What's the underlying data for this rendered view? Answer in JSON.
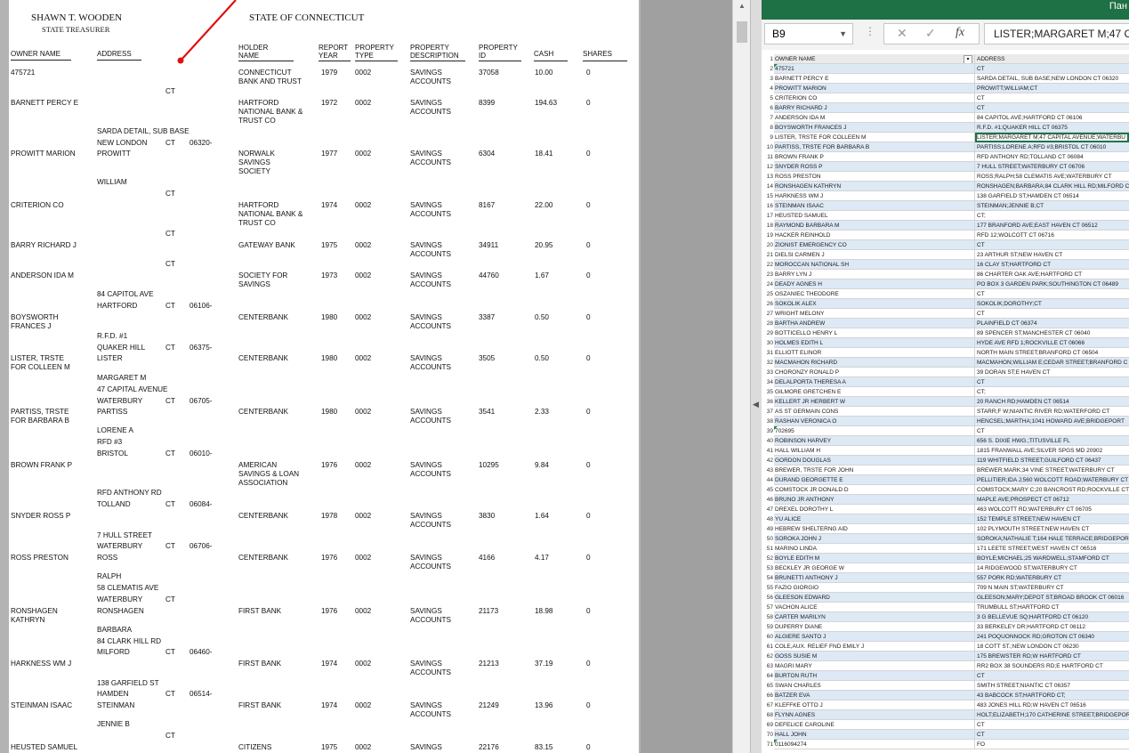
{
  "document": {
    "header_left_name": "SHAWN T. WOODEN",
    "header_left_title": "STATE TREASURER",
    "header_center": "STATE OF CONNECTICUT",
    "columns": {
      "owner_name": "OWNER NAME",
      "address": "ADDRESS",
      "holder_name_1": "HOLDER",
      "holder_name_2": "NAME",
      "report_year_1": "REPORT",
      "report_year_2": "YEAR",
      "property_type_1": "PROPERTY",
      "property_type_2": "TYPE",
      "property_desc_1": "PROPERTY",
      "property_desc_2": "DESCRIPTION",
      "property_id_1": "PROPERTY",
      "property_id_2": "ID",
      "cash": "CASH",
      "shares": "SHARES"
    },
    "address_fragments": [
      "CT",
      "SARDA DETAIL, SUB BASE",
      "NEW LONDON",
      "CT",
      "06320-",
      "PROWITT",
      "WILLIAM",
      "CT",
      "CT",
      "CT",
      "84 CAPITOL AVE",
      "HARTFORD",
      "CT",
      "06106-",
      "R.F.D. #1",
      "QUAKER HILL",
      "CT",
      "06375-",
      "LISTER",
      "MARGARET M",
      "47 CAPITAL AVENUE",
      "WATERBURY",
      "CT",
      "06705-",
      "PARTISS",
      "LORENE A",
      "RFD #3",
      "BRISTOL",
      "CT",
      "06010-",
      "RFD ANTHONY RD",
      "TOLLAND",
      "CT",
      "06084-",
      "7 HULL STREET",
      "WATERBURY",
      "CT",
      "06706-",
      "ROSS",
      "RALPH",
      "58 CLEMATIS AVE",
      "WATERBURY",
      "CT",
      "RONSHAGEN",
      "BARBARA",
      "84 CLARK HILL RD",
      "MILFORD",
      "CT",
      "06460-",
      "138 GARFIELD ST",
      "HAMDEN",
      "CT",
      "06514-",
      "STEINMAN",
      "JENNIE B",
      "CT"
    ],
    "records": [
      {
        "owner": [
          "475721"
        ],
        "holder": [
          "CONNECTICUT",
          "BANK AND TRUST"
        ],
        "year": "1979",
        "type": "0002",
        "desc": [
          "SAVINGS",
          "ACCOUNTS"
        ],
        "id": "37058",
        "cash": "10.00",
        "shares": "0"
      },
      {
        "owner": [
          "BARNETT PERCY E"
        ],
        "holder": [
          "HARTFORD",
          "NATIONAL BANK &",
          "TRUST CO"
        ],
        "year": "1972",
        "type": "0002",
        "desc": [
          "SAVINGS",
          "ACCOUNTS"
        ],
        "id": "8399",
        "cash": "194.63",
        "shares": "0"
      },
      {
        "owner": [
          "PROWITT MARION"
        ],
        "holder": [
          "NORWALK",
          "SAVINGS",
          "SOCIETY"
        ],
        "year": "1977",
        "type": "0002",
        "desc": [
          "SAVINGS",
          "ACCOUNTS"
        ],
        "id": "6304",
        "cash": "18.41",
        "shares": "0"
      },
      {
        "owner": [
          "CRITERION CO"
        ],
        "holder": [
          "HARTFORD",
          "NATIONAL BANK &",
          "TRUST CO"
        ],
        "year": "1974",
        "type": "0002",
        "desc": [
          "SAVINGS",
          "ACCOUNTS"
        ],
        "id": "8167",
        "cash": "22.00",
        "shares": "0"
      },
      {
        "owner": [
          "BARRY RICHARD J"
        ],
        "holder": [
          "GATEWAY BANK"
        ],
        "year": "1975",
        "type": "0002",
        "desc": [
          "SAVINGS",
          "ACCOUNTS"
        ],
        "id": "34911",
        "cash": "20.95",
        "shares": "0"
      },
      {
        "owner": [
          "ANDERSON IDA M"
        ],
        "holder": [
          "SOCIETY FOR",
          "SAVINGS"
        ],
        "year": "1973",
        "type": "0002",
        "desc": [
          "SAVINGS",
          "ACCOUNTS"
        ],
        "id": "44760",
        "cash": "1.67",
        "shares": "0"
      },
      {
        "owner": [
          "BOYSWORTH",
          "FRANCES J"
        ],
        "holder": [
          "CENTERBANK"
        ],
        "year": "1980",
        "type": "0002",
        "desc": [
          "SAVINGS",
          "ACCOUNTS"
        ],
        "id": "3387",
        "cash": "0.50",
        "shares": "0"
      },
      {
        "owner": [
          "LISTER, TRSTE",
          "FOR COLLEEN M"
        ],
        "holder": [
          "CENTERBANK"
        ],
        "year": "1980",
        "type": "0002",
        "desc": [
          "SAVINGS",
          "ACCOUNTS"
        ],
        "id": "3505",
        "cash": "0.50",
        "shares": "0"
      },
      {
        "owner": [
          "PARTISS, TRSTE",
          "FOR BARBARA B"
        ],
        "holder": [
          "CENTERBANK"
        ],
        "year": "1980",
        "type": "0002",
        "desc": [
          "SAVINGS",
          "ACCOUNTS"
        ],
        "id": "3541",
        "cash": "2.33",
        "shares": "0"
      },
      {
        "owner": [
          "BROWN FRANK P"
        ],
        "holder": [
          "AMERICAN",
          "SAVINGS & LOAN",
          "ASSOCIATION"
        ],
        "year": "1976",
        "type": "0002",
        "desc": [
          "SAVINGS",
          "ACCOUNTS"
        ],
        "id": "10295",
        "cash": "9.84",
        "shares": "0"
      },
      {
        "owner": [
          "SNYDER ROSS P"
        ],
        "holder": [
          "CENTERBANK"
        ],
        "year": "1978",
        "type": "0002",
        "desc": [
          "SAVINGS",
          "ACCOUNTS"
        ],
        "id": "3830",
        "cash": "1.64",
        "shares": "0"
      },
      {
        "owner": [
          "ROSS PRESTON"
        ],
        "holder": [
          "CENTERBANK"
        ],
        "year": "1976",
        "type": "0002",
        "desc": [
          "SAVINGS",
          "ACCOUNTS"
        ],
        "id": "4166",
        "cash": "4.17",
        "shares": "0"
      },
      {
        "owner": [
          "RONSHAGEN",
          "KATHRYN"
        ],
        "holder": [
          "FIRST BANK"
        ],
        "year": "1976",
        "type": "0002",
        "desc": [
          "SAVINGS",
          "ACCOUNTS"
        ],
        "id": "21173",
        "cash": "18.98",
        "shares": "0"
      },
      {
        "owner": [
          "HARKNESS WM J"
        ],
        "holder": [
          "FIRST BANK"
        ],
        "year": "1974",
        "type": "0002",
        "desc": [
          "SAVINGS",
          "ACCOUNTS"
        ],
        "id": "21213",
        "cash": "37.19",
        "shares": "0"
      },
      {
        "owner": [
          "STEINMAN ISAAC"
        ],
        "holder": [
          "FIRST BANK"
        ],
        "year": "1974",
        "type": "0002",
        "desc": [
          "SAVINGS",
          "ACCOUNTS"
        ],
        "id": "21249",
        "cash": "13.96",
        "shares": "0"
      },
      {
        "owner": [
          "HEUSTED SAMUEL"
        ],
        "holder": [
          "CITIZENS"
        ],
        "year": "1975",
        "type": "0002",
        "desc": [
          "SAVINGS"
        ],
        "id": "22176",
        "cash": "83.15",
        "shares": "0"
      }
    ]
  },
  "excel": {
    "title_fragment": "Пан",
    "name_box": "B9",
    "formula_content": "LISTER;MARGARET M;47 C",
    "header": {
      "row": "1",
      "col_a": "OWNER NAME",
      "col_b": "ADDRESS"
    },
    "rows": [
      [
        "2",
        "475721",
        "CT"
      ],
      [
        "3",
        "BARNETT PERCY E",
        "SARDA DETAIL, SUB BASE;NEW LONDON CT 06320"
      ],
      [
        "4",
        "PROWITT MARION",
        "PROWITT;WILLIAM;CT"
      ],
      [
        "5",
        "CRITERION CO",
        "CT"
      ],
      [
        "6",
        "BARRY RICHARD J",
        "CT"
      ],
      [
        "7",
        "ANDERSON IDA M",
        "84 CAPITOL AVE;HARTFORD CT 06106"
      ],
      [
        "8",
        "BOYSWORTH FRANCES J",
        "R.F.D. #1;QUAKER HILL CT 06375"
      ],
      [
        "9",
        "LISTER, TRSTE FOR COLLEEN M",
        "LISTER;MARGARET M;47 CAPITAL AVENUE;WATERBU"
      ],
      [
        "10",
        "PARTISS, TRSTE FOR BARBARA B",
        "PARTISS;LORENE A;RFD #3;BRISTOL CT 06010"
      ],
      [
        "11",
        "BROWN FRANK P",
        "RFD ANTHONY RD;TOLLAND CT 06084"
      ],
      [
        "12",
        "SNYDER ROSS P",
        "7 HULL STREET;WATERBURY CT 06706"
      ],
      [
        "13",
        "ROSS PRESTON",
        "ROSS;RALPH;58 CLEMATIS AVE;WATERBURY CT"
      ],
      [
        "14",
        "RONSHAGEN KATHRYN",
        "RONSHAGEN;BARBARA;84 CLARK HILL RD;MILFORD C"
      ],
      [
        "15",
        "HARKNESS WM J",
        "138 GARFIELD ST;HAMDEN CT 06514"
      ],
      [
        "16",
        "STEINMAN ISAAC",
        "STEINMAN;JENNIE B;CT"
      ],
      [
        "17",
        "HEUSTED SAMUEL",
        "CT;"
      ],
      [
        "18",
        "RAYMOND BARBARA M",
        "177 BRANFORD AVE;EAST HAVEN CT 06512"
      ],
      [
        "19",
        "HACKER REINHOLD",
        "RFD 12;WOLCOTT CT 06716"
      ],
      [
        "20",
        "ZIONIST EMERGENCY CO",
        "CT"
      ],
      [
        "21",
        "DIELSI CARMEN J",
        "23 ARTHUR ST;NEW HAVEN CT"
      ],
      [
        "22",
        "MOROCCAN NATIONAL SH",
        "16 CLAY ST;HARTFORD CT"
      ],
      [
        "23",
        "BARRY LYN J",
        "86 CHARTER OAK AVE;HARTFORD CT"
      ],
      [
        "24",
        "DEADY AGNES H",
        "PO BOX 3 GARDEN PARK;SOUTHINGTON CT 06489"
      ],
      [
        "25",
        "OSZANIEC THEODORE",
        "CT"
      ],
      [
        "26",
        "SOKOLIK ALEX",
        "SOKOLIK;DOROTHY;CT"
      ],
      [
        "27",
        "WRIGHT MELONY",
        "CT"
      ],
      [
        "28",
        "BARTHA ANDREW",
        "PLAINFIELD CT 06374"
      ],
      [
        "29",
        "BOTTICELLO HENRY L",
        "89 SPENCER ST;MANCHESTER CT 06040"
      ],
      [
        "30",
        "HOLMES EDITH L",
        "HYDE AVE RFD 1;ROCKVILLE CT 06066"
      ],
      [
        "31",
        "ELLIOTT ELINOR",
        "NORTH MAIN STREET;BRANFORD CT 06504"
      ],
      [
        "32",
        "MACMAHON RICHARD",
        "MACMAHON;WILLIAM E;CEDAR STREET;BRANFORD C"
      ],
      [
        "33",
        "CHORONZY RONALD P",
        "39 DORAN ST;E HAVEN CT"
      ],
      [
        "34",
        "DELALPORTA THERESA A",
        "CT"
      ],
      [
        "35",
        "GILMORE GRETCHEN E",
        "CT;"
      ],
      [
        "36",
        "KELLERT JR HERBERT W",
        "20 RANCH RD;HAMDEN CT 06514"
      ],
      [
        "37",
        "AS ST GERMAIN CONS",
        "STARR;F W;NIANTIC RIVER RD;WATERFORD CT"
      ],
      [
        "38",
        "RASHAN VERONICA O",
        "HENCSEL;MARTHA;1041 HOWARD AVE;BRIDGEPORT"
      ],
      [
        "39",
        "702695",
        "CT"
      ],
      [
        "40",
        "ROBINSON HARVEY",
        "656 S. DIXIE HWG.;TITUSVILLE FL"
      ],
      [
        "41",
        "HALL WILLIAM H",
        "1815 FRANWALL AVE;SILVER SPGS MD 20902"
      ],
      [
        "42",
        "GORDON DOUGLAS",
        "119 WHITFIELD STREET;GUILFORD CT 06437"
      ],
      [
        "43",
        "BREWER, TRSTE FOR JOHN",
        "BREWER;MARK;34 VINE STREET;WATERBURY CT"
      ],
      [
        "44",
        "DURAND GEORGETTE E",
        "PELLITIER;IDA J;560 WOLCOTT ROAD;WATERBURY CT"
      ],
      [
        "45",
        "COMSTOCK JR DONALD D",
        "COMSTOCK;MARY C;20 BANCROST RD;ROCKVILLE CT"
      ],
      [
        "46",
        "BRUNO JR ANTHONY",
        "MAPLE AVE;PROSPECT CT 06712"
      ],
      [
        "47",
        "DREXEL DOROTHY L",
        "463 WOLCOTT RD;WATERBURY CT 06705"
      ],
      [
        "48",
        "YU ALICE",
        "152 TEMPLE STREET;NEW HAVEN CT"
      ],
      [
        "49",
        "HEBREW SHELTERNG AID",
        "102 PLYMOUTH STREET;NEW HAVEN CT"
      ],
      [
        "50",
        "SOROKA JOHN J",
        "SOROKA;NATHALIE T;164 HALE TERRACE;BRIDGEPOR"
      ],
      [
        "51",
        "MARINO LINDA",
        "171 LEETE STREET;WEST HAVEN CT 06516"
      ],
      [
        "52",
        "BOYLE EDITH M",
        "BOYLE;MICHAEL;25 WARDWELL;STAMFORD CT"
      ],
      [
        "53",
        "BECKLEY JR GEORGE W",
        "14 RIDGEWOOD ST;WATERBURY CT"
      ],
      [
        "54",
        "BRUNETTI ANTHONY J",
        "557 PORK RD;WATERBURY CT"
      ],
      [
        "55",
        "FAZIO GIORGIO",
        "709 N MAIN ST;WATERBURY CT"
      ],
      [
        "56",
        "GLEESON EDWARD",
        "GLEESON;MARY;DEPOT ST;BROAD BROOK CT 06016"
      ],
      [
        "57",
        "VACHON ALICE",
        "TRUMBULL ST;HARTFORD CT"
      ],
      [
        "58",
        "CARTER MARILYN",
        "3 G BELLEVUE SQ;HARTFORD CT 06120"
      ],
      [
        "59",
        "DUPERRY DIANE",
        "33 BERKELEY DR;HARTFORD CT 06112"
      ],
      [
        "60",
        "ALGIERE SANTO J",
        "241 POQUONNOCK RD;GROTON CT 06340"
      ],
      [
        "61",
        "COLE,AUX. RELIEF FND EMILY J",
        "18 COTT ST.;NEW LONDON CT 06230"
      ],
      [
        "62",
        "GOSS SUSIE M",
        "175 BREWSTER RD;W HARTFORD CT"
      ],
      [
        "63",
        "MAGRI MARY",
        "RR2 BOX 38 SOUNDERS RD;E HARTFORD CT"
      ],
      [
        "64",
        "BURTON RUTH",
        "CT"
      ],
      [
        "65",
        "SWAN CHARLES",
        "SMITH STREET;NIANTIC CT 06357"
      ],
      [
        "66",
        "BATZER EVA",
        "43 BABCOCK ST;HARTFORD CT;"
      ],
      [
        "67",
        "KLEFFKE OTTO J",
        "483 JONES HILL RD;W HAVEN CT 06516"
      ],
      [
        "68",
        "FLYNN AGNES",
        "HOLT;ELIZABETH;170 CATHERINE STREET;BRIDGEPOR"
      ],
      [
        "69",
        "DEFELICE CAROLINE",
        "CT"
      ],
      [
        "70",
        "HALL JOHN",
        "CT"
      ],
      [
        "71",
        "0116094274",
        "FO"
      ]
    ]
  }
}
